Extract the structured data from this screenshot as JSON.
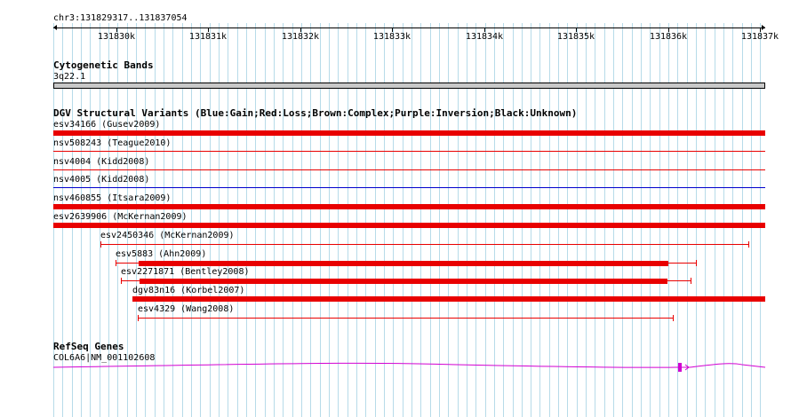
{
  "locus": "chr3:131829317..131837054",
  "ruler": {
    "ticks": [
      {
        "pos": 131830000,
        "label": "131830k"
      },
      {
        "pos": 131831000,
        "label": "131831k"
      },
      {
        "pos": 131832000,
        "label": "131832k"
      },
      {
        "pos": 131833000,
        "label": "131833k"
      },
      {
        "pos": 131834000,
        "label": "131834k"
      },
      {
        "pos": 131835000,
        "label": "131835k"
      },
      {
        "pos": 131836000,
        "label": "131836k"
      },
      {
        "pos": 131837000,
        "label": "131837k"
      }
    ]
  },
  "tracks": {
    "cytoband": {
      "title": "Cytogenetic Bands",
      "band": "3q22.1"
    },
    "dgv": {
      "title": "DGV Structural Variants (Blue:Gain;Red:Loss;Brown:Complex;Purple:Inversion;Black:Unknown)",
      "colors": {
        "gain": "#0000cc",
        "loss": "#e80000",
        "complex": "#8b4513",
        "inversion": "#800080",
        "unknown": "#000000"
      },
      "variants": [
        {
          "label": "esv34166 (Gusev2009)",
          "type": "loss",
          "style": "thick",
          "start": 131829317,
          "end": 131837054
        },
        {
          "label": "nsv508243 (Teague2010)",
          "type": "loss",
          "style": "thin",
          "start": 131829317,
          "end": 131837054
        },
        {
          "label": "nsv4004 (Kidd2008)",
          "type": "loss",
          "style": "thin",
          "start": 131829317,
          "end": 131837054
        },
        {
          "label": "nsv4005 (Kidd2008)",
          "type": "gain",
          "style": "thin",
          "start": 131829317,
          "end": 131837054
        },
        {
          "label": "nsv460855 (Itsara2009)",
          "type": "loss",
          "style": "thick",
          "start": 131829317,
          "end": 131837054
        },
        {
          "label": "esv2639906 (McKernan2009)",
          "type": "loss",
          "style": "thick",
          "start": 131829317,
          "end": 131837054
        },
        {
          "label": "esv2450346 (McKernan2009)",
          "type": "loss",
          "style": "span",
          "start": 131829830,
          "end": 131836870
        },
        {
          "label": "esv5883 (Ahn2009)",
          "type": "loss",
          "style": "span",
          "start": 131829990,
          "end": 131836300,
          "core": [
            131830240,
            131836000
          ]
        },
        {
          "label": "esv2271871 (Bentley2008)",
          "type": "loss",
          "style": "span",
          "start": 131830050,
          "end": 131836240,
          "core": [
            131830250,
            131835990
          ]
        },
        {
          "label": "dgv83n16 (Korbel2007)",
          "type": "loss",
          "style": "thick",
          "start": 131830180,
          "end": 131837054
        },
        {
          "label": "esv4329 (Wang2008)",
          "type": "loss",
          "style": "span",
          "start": 131830230,
          "end": 131836050
        }
      ]
    },
    "refseq": {
      "title": "RefSeq Genes",
      "gene": "COL6A6|NM_001102608",
      "color": "#d200d2"
    }
  }
}
